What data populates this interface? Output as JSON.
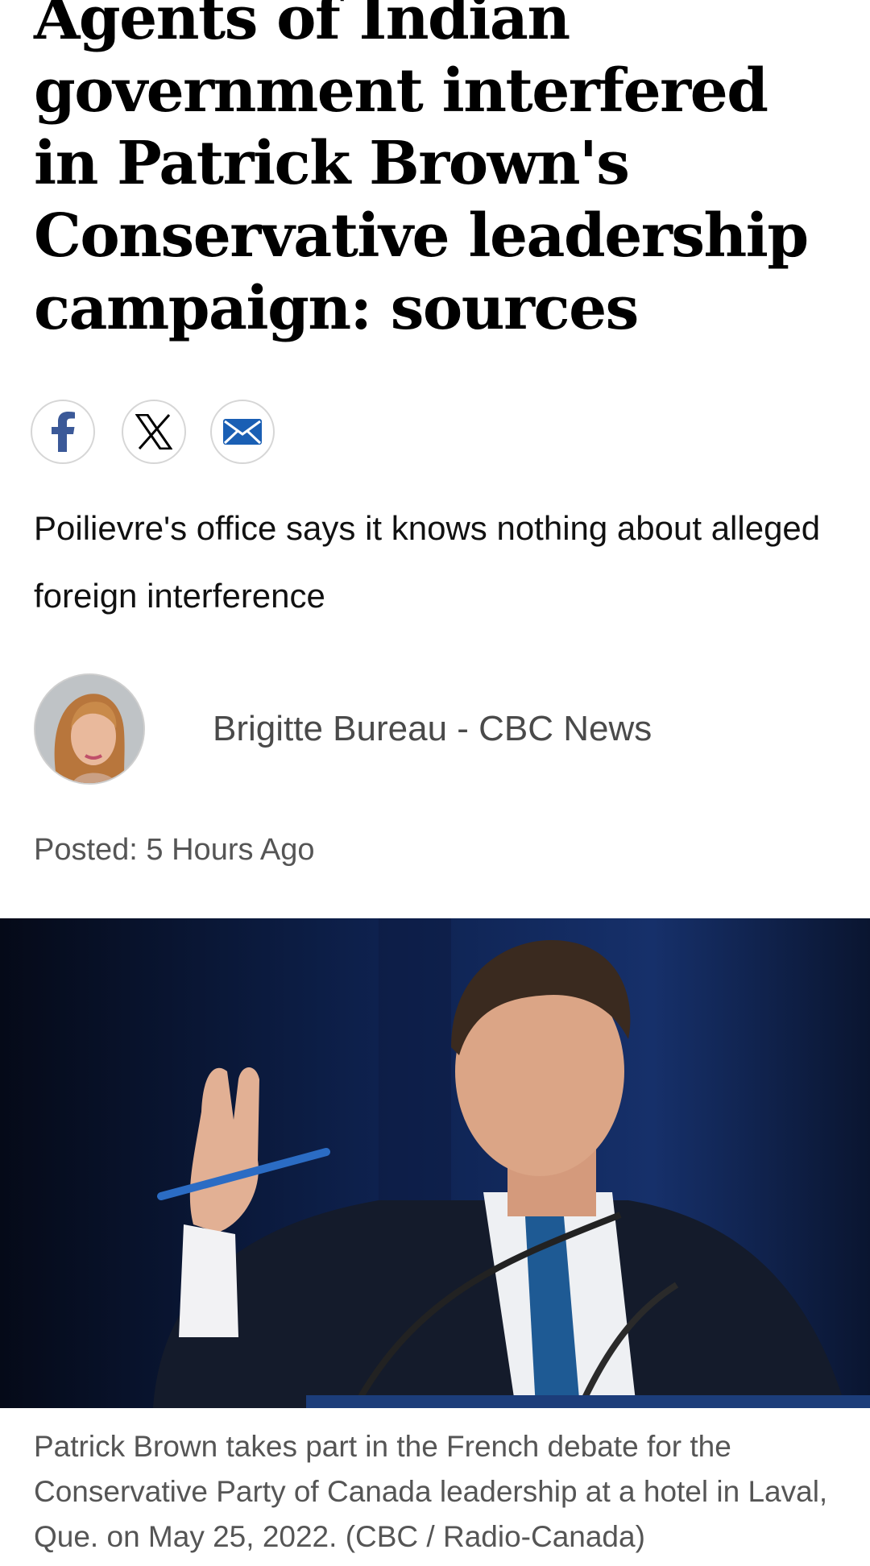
{
  "article": {
    "headline": "Agents of Indian government interfered in Patrick Brown's Conservative leadership campaign: sources",
    "dek": "Poilievre's office says it knows nothing about alleged foreign interference",
    "author": "Brigitte Bureau - CBC News",
    "posted": "Posted: 5 Hours Ago",
    "caption": "Patrick Brown takes part in the French debate for the Conservative Party of Canada leadership at a hotel in Laval, Que. on May 25, 2022. (CBC / Radio-Canada)"
  },
  "share": [
    {
      "icon": "facebook-icon",
      "glyph": "f"
    },
    {
      "icon": "x-icon",
      "glyph": "𝕏"
    },
    {
      "icon": "email-icon",
      "glyph": "✉"
    }
  ],
  "colors": {
    "facebook": "#3b5998",
    "email": "#1a5fb4",
    "text_muted": "#555555"
  }
}
